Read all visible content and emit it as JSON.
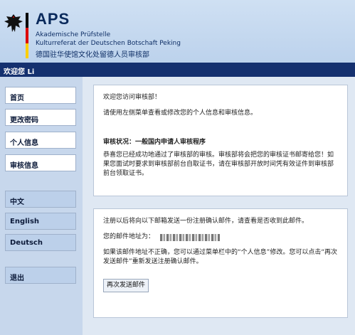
{
  "header": {
    "logo_text": "APS",
    "line1": "Akademische Prüfstelle",
    "line2": "Kulturreferat der Deutschen Botschaft Peking",
    "line3": "德国驻华使馆文化处留德人员审核部",
    "flag_colors": [
      "#000000",
      "#dd0000",
      "#ffce00"
    ]
  },
  "welcome_bar": {
    "text": "欢迎您 Li"
  },
  "sidebar": {
    "items": [
      {
        "label": "首页"
      },
      {
        "label": "更改密码"
      },
      {
        "label": "个人信息"
      },
      {
        "label": "审核信息"
      }
    ],
    "languages": [
      {
        "label": "中文"
      },
      {
        "label": "English"
      },
      {
        "label": "Deutsch"
      }
    ],
    "logout_label": "退出"
  },
  "info_panel": {
    "greeting": "欢迎您访问审核部！",
    "instructions": "请使用左侧菜单查看或修改您的个人信息和审核信息。",
    "status_title": "审核状况：一般国内申请人审核程序",
    "status_text": "恭喜您已经成功地通过了审核部的审核。审核部将会把您的审核证书邮寄给您！如果您面试时要求到审核部前台自取证书，请在审核部开放时间凭有效证件到审核部前台领取证书。"
  },
  "email_panel": {
    "notice": "注册以后将向以下邮箱发送一份注册确认邮件，请查看是否收到此邮件。",
    "email_label": "您的邮件地址为：",
    "incorrect_notice": "如果该邮件地址不正确，您可以通过菜单栏中的“个人信息”修改。您可以点击“再次发送邮件”重新发送注册确认邮件。",
    "resend_label": "再次发送邮件"
  },
  "colors": {
    "header_bg": "#c6d9f0",
    "welcome_bar_bg": "#14306f",
    "sidebar_bg": "#c7d7ec",
    "page_bg": "#dfe8f3"
  }
}
